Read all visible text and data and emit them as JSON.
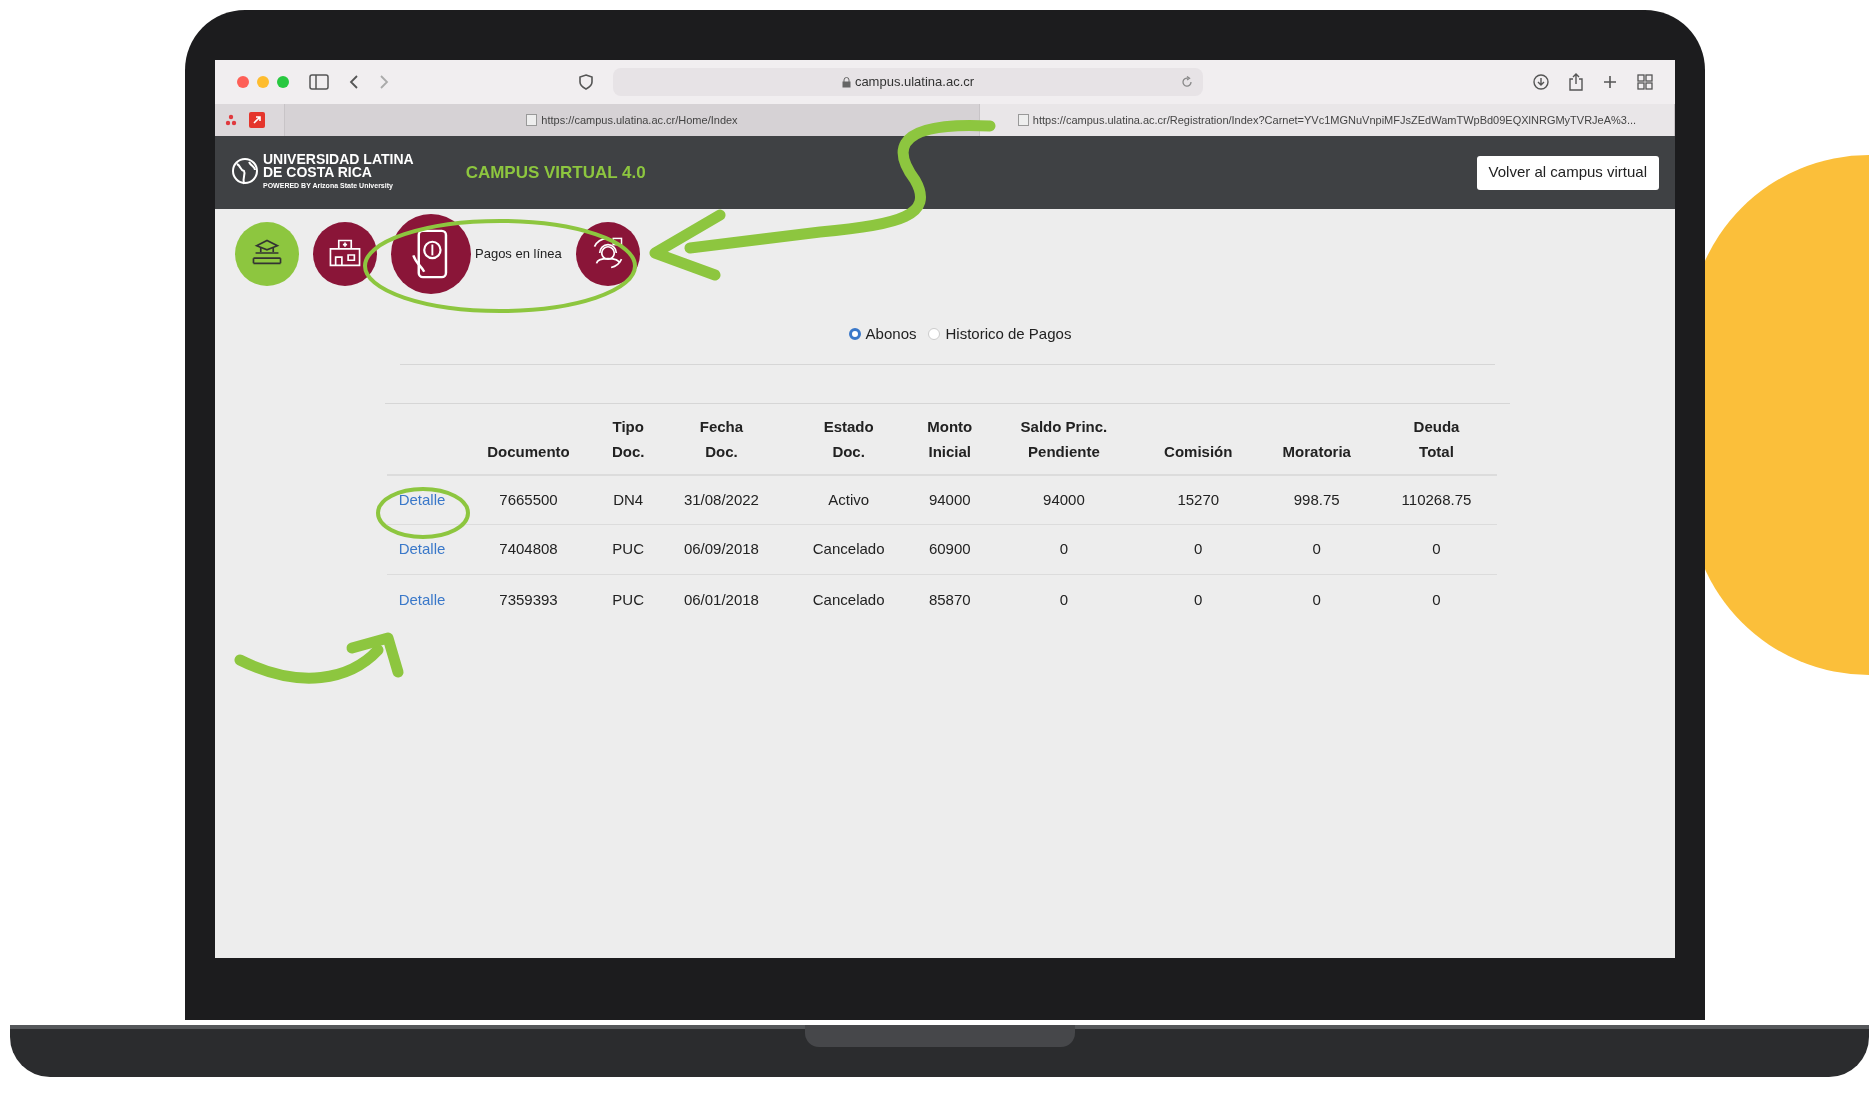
{
  "browser": {
    "address": "campus.ulatina.ac.cr",
    "tabs": [
      {
        "label": "https://campus.ulatina.ac.cr/Home/Index",
        "selected": false
      },
      {
        "label": "https://campus.ulatina.ac.cr/Registration/Index?Carnet=YVc1MGNuVnpiMFJsZEdWamTWpBd09EQXlNRGMyTVRJeA%3...",
        "selected": true
      }
    ]
  },
  "header": {
    "logo_lines": [
      "UNIVERSIDAD LATINA",
      "DE COSTA RICA"
    ],
    "logo_tagline": "POWERED BY Arizona State University",
    "title": "CAMPUS VIRTUAL 4.0",
    "button": "Volver al campus virtual"
  },
  "modules": [
    {
      "kind": "books",
      "color": "#8dc63f"
    },
    {
      "kind": "clinic",
      "color": "#8a1538"
    },
    {
      "kind": "payment",
      "color": "#8a1538",
      "label": "Pagos en línea"
    },
    {
      "kind": "support",
      "color": "#8a1538"
    }
  ],
  "view_options": [
    {
      "label": "Abonos",
      "selected": true
    },
    {
      "label": "Historico de Pagos",
      "selected": false
    }
  ],
  "table": {
    "columns": [
      "Documento",
      "Tipo\nDoc.",
      "Fecha\nDoc.",
      "Estado\nDoc.",
      "Monto\nInicial",
      "Saldo Princ.\nPendiente",
      "Comisión",
      "Moratoria",
      "Deuda\nTotal"
    ],
    "rows": [
      {
        "action": "Detalle",
        "cells": [
          "7665500",
          "DN4",
          "31/08/2022",
          "Activo",
          "94000",
          "94000",
          "15270",
          "998.75",
          "110268.75"
        ]
      },
      {
        "action": "Detalle",
        "cells": [
          "7404808",
          "PUC",
          "06/09/2018",
          "Cancelado",
          "60900",
          "0",
          "0",
          "0",
          "0"
        ]
      },
      {
        "action": "Detalle",
        "cells": [
          "7359393",
          "PUC",
          "06/01/2018",
          "Cancelado",
          "85870",
          "0",
          "0",
          "0",
          "0"
        ]
      }
    ]
  }
}
